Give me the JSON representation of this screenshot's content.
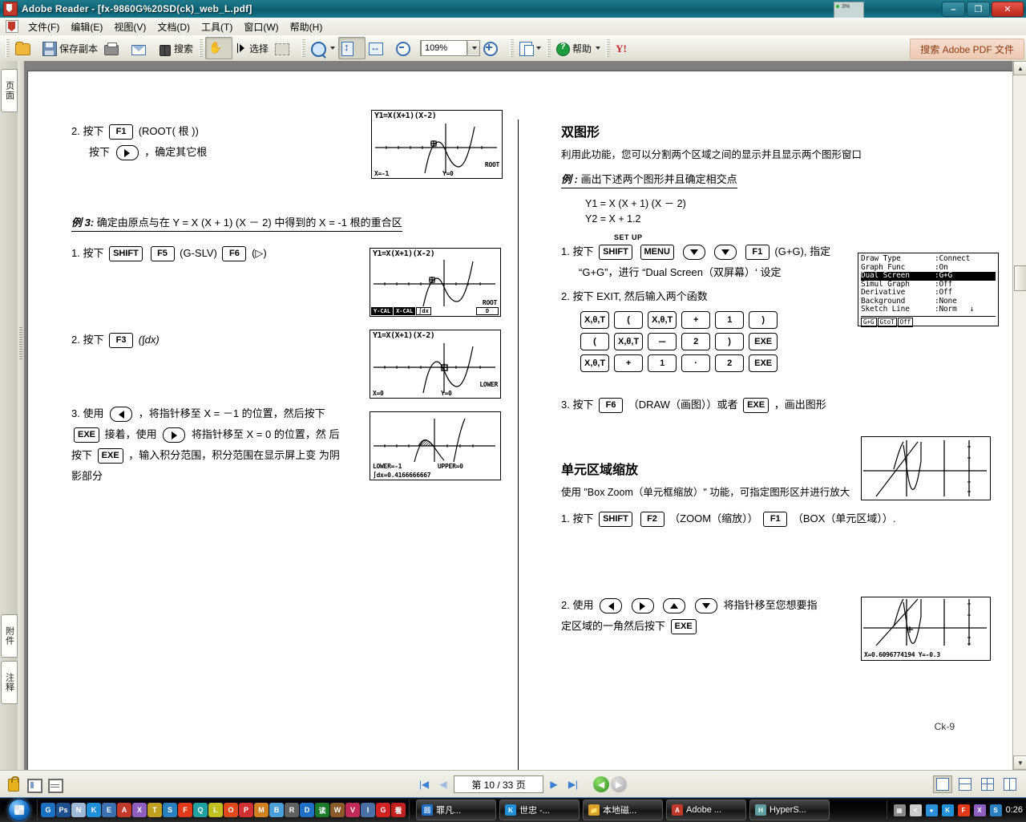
{
  "window": {
    "title": "Adobe Reader - [fx-9860G%20SD(ck)_web_L.pdf]",
    "minimize": "–",
    "maximize": "❐",
    "close": "✕"
  },
  "menubar": {
    "items": [
      {
        "label": "文件(F)"
      },
      {
        "label": "编辑(E)"
      },
      {
        "label": "视图(V)"
      },
      {
        "label": "文档(D)"
      },
      {
        "label": "工具(T)"
      },
      {
        "label": "窗口(W)"
      },
      {
        "label": "帮助(H)"
      }
    ]
  },
  "toolbar": {
    "open_label": "",
    "save_copy_label": "保存副本",
    "search_label": "搜索",
    "select_label": "选择",
    "zoom_value": "109%",
    "help_label": "帮助",
    "search_pdf_label": "搜索 Adobe PDF 文件"
  },
  "cpu_meter": {
    "value": "3%"
  },
  "navpane": {
    "tabs": [
      {
        "label": "页面"
      },
      {
        "label": "附件"
      },
      {
        "label": "注释"
      }
    ]
  },
  "statusbar": {
    "page_field": "第 10 / 33 页",
    "first": "|◀",
    "prev": "◀",
    "next": "▶",
    "last": "▶|",
    "back": "◀",
    "forward": "▶"
  },
  "taskbar": {
    "tasks": [
      {
        "label": "罪凡...",
        "color": "#1f6fc4",
        "glyph": "回"
      },
      {
        "label": "世忠 -...",
        "color": "#1f8fd8",
        "glyph": "K"
      },
      {
        "label": "本地磁...",
        "color": "#d8a12a",
        "glyph": "📁"
      },
      {
        "label": "Adobe ...",
        "color": "#c0392b",
        "glyph": "A"
      },
      {
        "label": "HyperS...",
        "color": "#5f9ea0",
        "glyph": "H"
      }
    ],
    "quicklaunch": [
      {
        "glyph": "G",
        "color": "#1a6fc0"
      },
      {
        "glyph": "Ps",
        "color": "#1d4f8f"
      },
      {
        "glyph": "N",
        "color": "#9fb8d8"
      },
      {
        "glyph": "K",
        "color": "#1f8fd8"
      },
      {
        "glyph": "E",
        "color": "#3a6fb0"
      },
      {
        "glyph": "A",
        "color": "#c0392b"
      },
      {
        "glyph": "X",
        "color": "#8f5fc0"
      },
      {
        "glyph": "T",
        "color": "#c0a020"
      },
      {
        "glyph": "S",
        "color": "#2a7fbf"
      },
      {
        "glyph": "F",
        "color": "#e03a1b"
      },
      {
        "glyph": "Q",
        "color": "#20a0a0"
      },
      {
        "glyph": "L",
        "color": "#c0c020"
      },
      {
        "glyph": "O",
        "color": "#e04a1b"
      },
      {
        "glyph": "P",
        "color": "#d03030"
      },
      {
        "glyph": "M",
        "color": "#d08020"
      },
      {
        "glyph": "B",
        "color": "#4a9fd8"
      },
      {
        "glyph": "R",
        "color": "#606060"
      },
      {
        "glyph": "D",
        "color": "#1f6fc4"
      },
      {
        "glyph": "读",
        "color": "#1a7a2a"
      },
      {
        "glyph": "W",
        "color": "#8a5a2a"
      },
      {
        "glyph": "V",
        "color": "#c02a5a"
      },
      {
        "glyph": "I",
        "color": "#4a6fa5"
      },
      {
        "glyph": "G",
        "color": "#d02020"
      },
      {
        "glyph": "看",
        "color": "#c02020"
      }
    ],
    "tray": {
      "clock": "0:26",
      "icons": [
        {
          "glyph": "▦",
          "color": "#888888"
        },
        {
          "glyph": "<",
          "color": "#cccccc"
        },
        {
          "glyph": "●",
          "color": "#2a8fd8"
        },
        {
          "glyph": "K",
          "color": "#1f8fd8"
        },
        {
          "glyph": "F",
          "color": "#e03a1b"
        },
        {
          "glyph": "X",
          "color": "#8f5fc0"
        },
        {
          "glyph": "S",
          "color": "#2a7fbf"
        }
      ]
    }
  },
  "document": {
    "page_footer": "Ck-9",
    "left_column": {
      "step2": {
        "num": "2. 按下",
        "key_f1": "F1",
        "after_key": "(ROOT( 根 ))",
        "line2_prefix": "按下",
        "line2_suffix": "，确定其它根"
      },
      "example3": {
        "label": "例 3:",
        "text": "确定由原点与在 Y = X (X + 1) (X － 2) 中得到的 X = -1 根的重合区"
      },
      "step_1": {
        "num": "1. 按下",
        "keys": [
          "SHIFT",
          "F5"
        ],
        "mid": "(G-SLV)",
        "key2": "F6",
        "tail": "(▷)"
      },
      "step_2b": {
        "num": "2. 按下",
        "key": "F3",
        "tail": "(∫dx)"
      },
      "step_3": {
        "num": "3. 使用",
        "p1": "，将指针移至 X = －1 的位置，然后按下",
        "key_exe1": "EXE",
        "p2": "接着，使用",
        "p3": "将指针移至 X = 0 的位置，然",
        "p4": "后按下",
        "key_exe2": "EXE",
        "p5": "，输入积分范围，积分范围在显示屏上变",
        "p6": "为阴影部分"
      },
      "screens": [
        {
          "header": "Y1=X(X+1)(X-2)",
          "mode": "ROOT",
          "x": "X=-1",
          "y": "Y=0",
          "fkeys": []
        },
        {
          "header": "Y1=X(X+1)(X-2)",
          "mode": "ROOT",
          "x": "",
          "y": "",
          "fkeys": [
            "Y-CAL",
            "X-CAL",
            "∫dx"
          ],
          "right_tag": "D"
        },
        {
          "header": "Y1=X(X+1)(X-2)",
          "mode": "LOWER",
          "x": "X=0",
          "y": "Y=0",
          "fkeys": []
        },
        {
          "header": "",
          "mode": "",
          "lower": "LOWER=-1",
          "upper": "UPPER=0",
          "integral": "∫dx=0.4166666667",
          "fkeys": []
        }
      ]
    },
    "right_column": {
      "heading1": "双图形",
      "intro1": "利用此功能，您可以分割两个区域之间的显示并且显示两个图形窗口",
      "example_label": "例 :",
      "example_text": "画出下述两个图形并且确定相交点",
      "formulas": [
        "Y1 = X (X + 1) (X － 2)",
        "Y2 = X + 1.2"
      ],
      "setup_caption": "SET UP",
      "step1": {
        "num": "1. 按下",
        "keys": [
          "SHIFT",
          "MENU"
        ],
        "key_f1": "F1",
        "tail": "(G+G), 指定",
        "line2": "“G+G”，进行 “Dual Screen（双屏幕）‘ 设定"
      },
      "step2": {
        "text": "2. 按下 EXIT, 然后输入两个函数"
      },
      "keypad_rows": [
        [
          "X,θ,T",
          "(",
          "X,θ,T",
          "+",
          "1",
          ")"
        ],
        [
          "(",
          "X,θ,T",
          "－",
          "2",
          ")",
          "EXE"
        ],
        [
          "X,θ,T",
          "+",
          "1",
          "·",
          "2",
          "EXE"
        ]
      ],
      "step3": {
        "num": "3. 按下",
        "key_f6": "F6",
        "mid": "（DRAW（画图））或者",
        "key_exe": "EXE",
        "tail": "，画出图形"
      },
      "heading2": "单元区域缩放",
      "intro2": "使用 \"Box Zoom（单元框缩放）\" 功能，可指定图形区并进行放大",
      "step_bz1": {
        "num": "1. 按下",
        "keys": [
          "SHIFT",
          "F2"
        ],
        "mid": "（ZOOM（缩放））",
        "key_f1": "F1",
        "tail": "（BOX（单元区域））."
      },
      "step_bz2": {
        "num": "2. 使用",
        "mid": "将指针移至您想要指",
        "line2": "定区域的一角然后按下",
        "key_exe": "EXE"
      },
      "setup_screen": {
        "rows": [
          {
            "k": "Draw Type",
            "v": ":Connect",
            "hl": false
          },
          {
            "k": "Graph Func",
            "v": ":On",
            "hl": false
          },
          {
            "k": "Dual Screen",
            "v": ":G+G",
            "hl": true
          },
          {
            "k": "Simul Graph",
            "v": ":Off",
            "hl": false
          },
          {
            "k": "Derivative",
            "v": ":Off",
            "hl": false
          },
          {
            "k": "Background",
            "v": ":None",
            "hl": false
          },
          {
            "k": "Sketch Line",
            "v": ":Norm",
            "hl": false
          }
        ],
        "fkeys": [
          "G+G",
          "GtoT",
          "Off"
        ],
        "scroll_arrow": "↓"
      },
      "dual_screens": [
        {
          "coords": ""
        },
        {
          "coords": "X=0.6096774194   Y=-0.3"
        }
      ]
    }
  }
}
